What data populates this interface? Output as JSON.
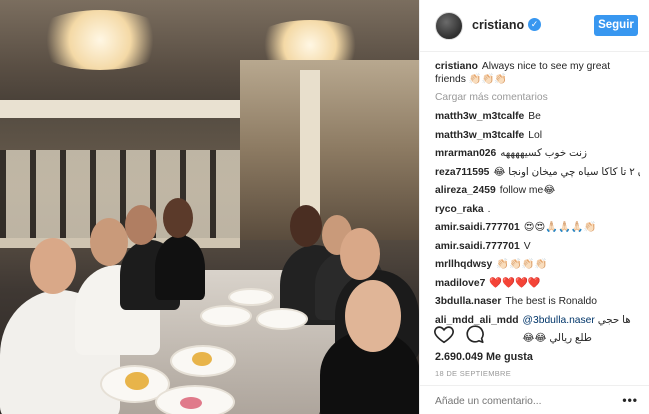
{
  "post": {
    "image_alt": "Group dinner photo",
    "header": {
      "username": "cristiano",
      "verified_symbol": "✓",
      "follow_label": "Seguir"
    },
    "caption": {
      "user": "cristiano",
      "text": "Always nice to see my great friends 👏🏻👏🏻👏🏻"
    },
    "load_more": "Cargar más comentarios",
    "comments": [
      {
        "user": "matth3w_m3tcalfe",
        "text": "Be"
      },
      {
        "user": "matth3w_m3tcalfe",
        "text": "Lol"
      },
      {
        "user": "mrarman026",
        "text": "زنت خوب کسيههههه"
      },
      {
        "user": "reza711595",
        "text": "اون ۲ تا کاکا سياه چي ميخان اونجا 😂"
      },
      {
        "user": "alireza_2459",
        "text": "follow me😂"
      },
      {
        "user": "ryco_raka",
        "text": "."
      },
      {
        "user": "amir.saidi.777701",
        "text": "😍😍🙏🏻🙏🏻🙏🏻👏🏻"
      },
      {
        "user": "amir.saidi.777701",
        "text": "V"
      },
      {
        "user": "mrllhqdwsy",
        "text": "👏🏻👏🏻👏🏻👏🏻"
      },
      {
        "user": "madilove7",
        "text": "❤️❤️❤️❤️"
      },
      {
        "user": "3bdulla.naser",
        "text": "The best is Ronaldo"
      },
      {
        "user": "ali_mdd_ali_mdd",
        "mention": "@3bdulla.naser",
        "text": "ها حجي"
      },
      {
        "user": "",
        "text": "طلع ريالي 😂😂"
      }
    ],
    "likes": "2.690.049 Me gusta",
    "date": "18 DE SEPTIEMBRE",
    "add_comment_placeholder": "Añade un comentario...",
    "more_options": "•••"
  },
  "icons": {
    "like": "heart-icon",
    "comment": "comment-bubble-icon"
  },
  "colors": {
    "accent": "#3897f0",
    "text": "#262626",
    "muted": "#999999",
    "border": "#efefef"
  }
}
